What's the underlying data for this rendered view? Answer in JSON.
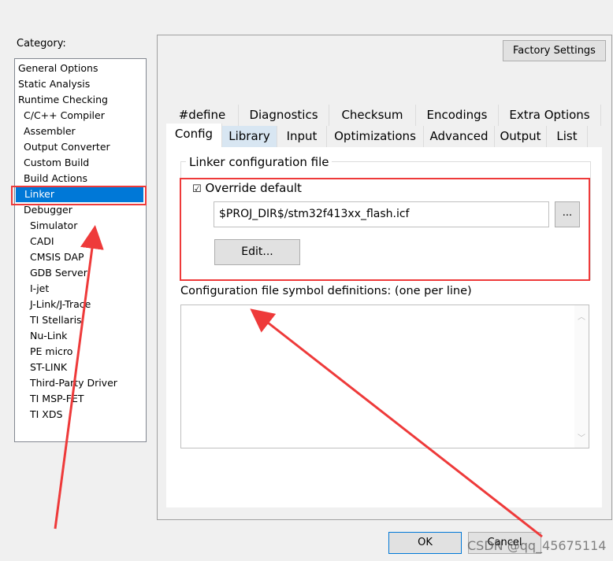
{
  "category": {
    "label": "Category:",
    "items": [
      {
        "label": "General Options",
        "level": 0
      },
      {
        "label": "Static Analysis",
        "level": 0
      },
      {
        "label": "Runtime Checking",
        "level": 0
      },
      {
        "label": "C/C++ Compiler",
        "level": 1
      },
      {
        "label": "Assembler",
        "level": 1
      },
      {
        "label": "Output Converter",
        "level": 1
      },
      {
        "label": "Custom Build",
        "level": 1
      },
      {
        "label": "Build Actions",
        "level": 1
      },
      {
        "label": "Linker",
        "level": 1,
        "selected": true
      },
      {
        "label": "Debugger",
        "level": 1
      },
      {
        "label": "Simulator",
        "level": 2
      },
      {
        "label": "CADI",
        "level": 2
      },
      {
        "label": "CMSIS DAP",
        "level": 2
      },
      {
        "label": "GDB Server",
        "level": 2
      },
      {
        "label": "I-jet",
        "level": 2
      },
      {
        "label": "J-Link/J-Trace",
        "level": 2
      },
      {
        "label": "TI Stellaris",
        "level": 2
      },
      {
        "label": "Nu-Link",
        "level": 2
      },
      {
        "label": "PE micro",
        "level": 2
      },
      {
        "label": "ST-LINK",
        "level": 2
      },
      {
        "label": "Third-Party Driver",
        "level": 2
      },
      {
        "label": "TI MSP-FET",
        "level": 2
      },
      {
        "label": "TI XDS",
        "level": 2
      }
    ]
  },
  "factory_settings": "Factory Settings",
  "tabs_row1": [
    "#define",
    "Diagnostics",
    "Checksum",
    "Encodings",
    "Extra Options"
  ],
  "tabs_row2": [
    "Config",
    "Library",
    "Input",
    "Optimizations",
    "Advanced",
    "Output",
    "List"
  ],
  "active_tab": "Config",
  "hover_tab": "Library",
  "config": {
    "group_label": "Linker configuration file",
    "override_label": "Override default",
    "override_checked": true,
    "file_path": "$PROJ_DIR$/stm32f413xx_flash.icf",
    "browse": "...",
    "edit": "Edit...",
    "symbols_label": "Configuration file symbol definitions: (one per line)",
    "symbols_value": ""
  },
  "ok": "OK",
  "cancel": "Cancel",
  "watermark": "CSDN @qq_45675114",
  "annotation_color": "#ee3a3a"
}
